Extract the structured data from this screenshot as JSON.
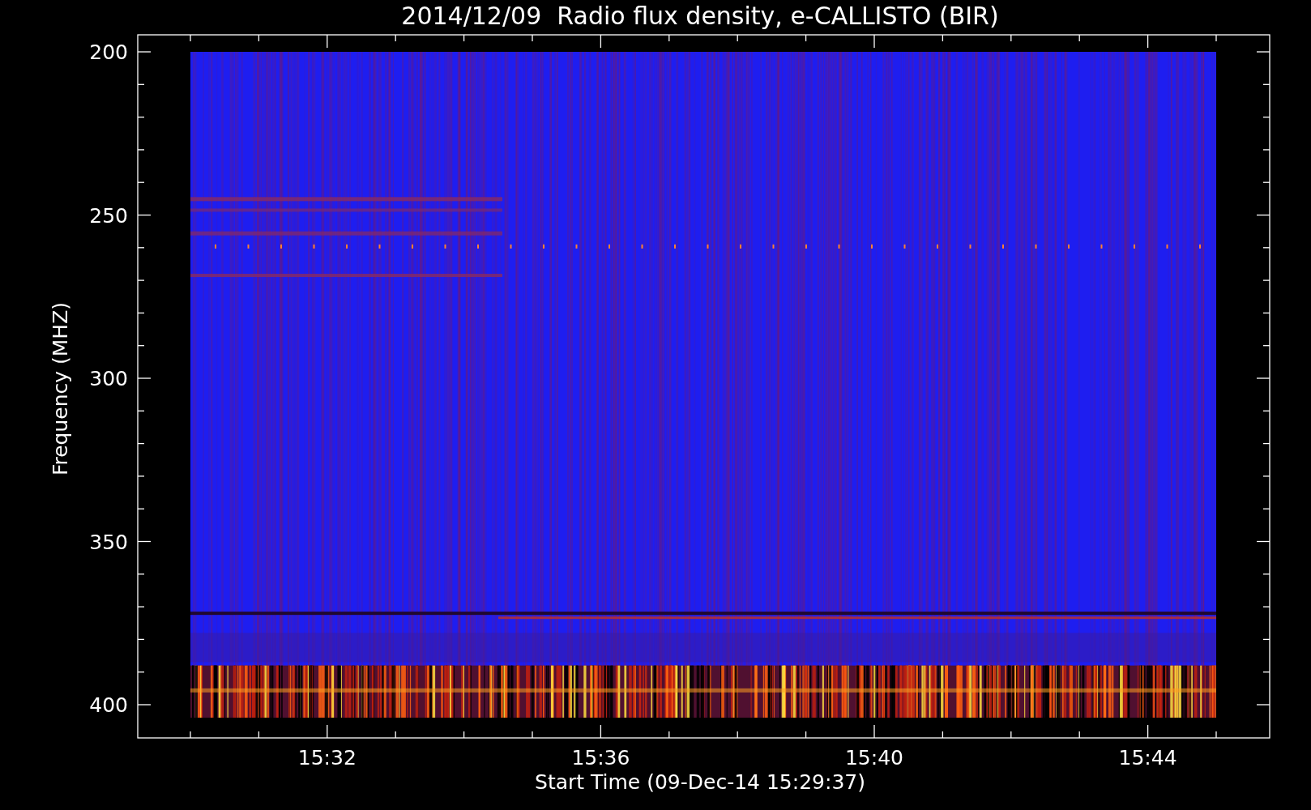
{
  "title": "2014/12/09  Radio flux density, e-CALLISTO (BIR)",
  "y_axis": {
    "label": "Frequency (MHZ)",
    "ticks": [
      "200",
      "250",
      "300",
      "350",
      "400"
    ]
  },
  "x_axis": {
    "label": "Start Time (09-Dec-14 15:29:37)",
    "ticks": [
      "15:32",
      "15:36",
      "15:40",
      "15:44"
    ]
  }
}
